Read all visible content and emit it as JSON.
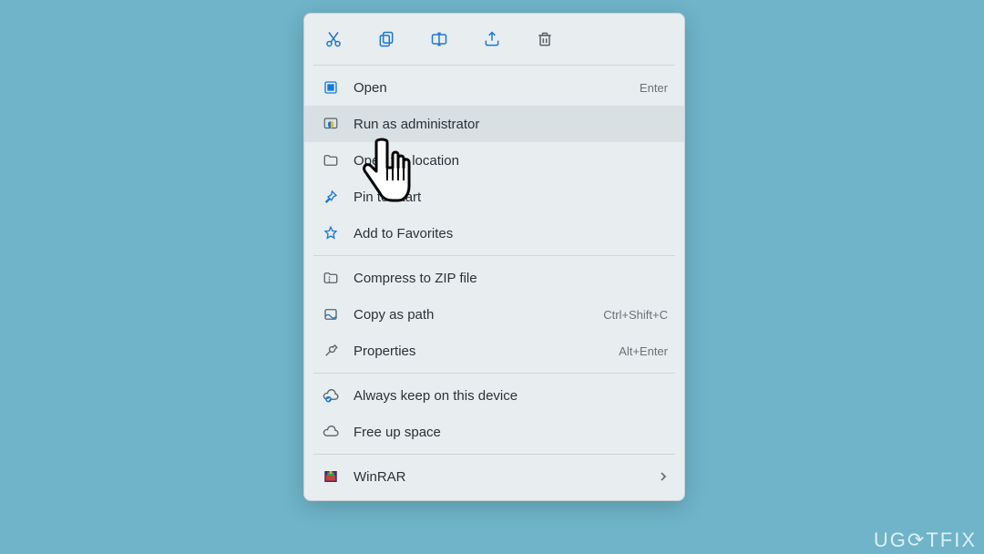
{
  "toolbar": {
    "items": [
      "cut-icon",
      "copy-icon",
      "rename-icon",
      "share-icon",
      "delete-icon"
    ]
  },
  "menu": {
    "open": {
      "label": "Open",
      "shortcut": "Enter"
    },
    "run_admin": {
      "label": "Run as administrator"
    },
    "open_loc": {
      "label": "Open file location"
    },
    "pin_start": {
      "label": "Pin to Start"
    },
    "favorites": {
      "label": "Add to Favorites"
    },
    "compress": {
      "label": "Compress to ZIP file"
    },
    "copy_path": {
      "label": "Copy as path",
      "shortcut": "Ctrl+Shift+C"
    },
    "properties": {
      "label": "Properties",
      "shortcut": "Alt+Enter"
    },
    "keep_device": {
      "label": "Always keep on this device"
    },
    "free_space": {
      "label": "Free up space"
    },
    "winrar": {
      "label": "WinRAR"
    }
  },
  "watermark": {
    "text": "UG⟳TFIX"
  },
  "colors": {
    "background": "#6fb4c9",
    "menu_bg": "#e8edef",
    "hover": "#d9e0e3",
    "icon_blue": "#1a78d6",
    "icon_gray": "#5a6268"
  }
}
